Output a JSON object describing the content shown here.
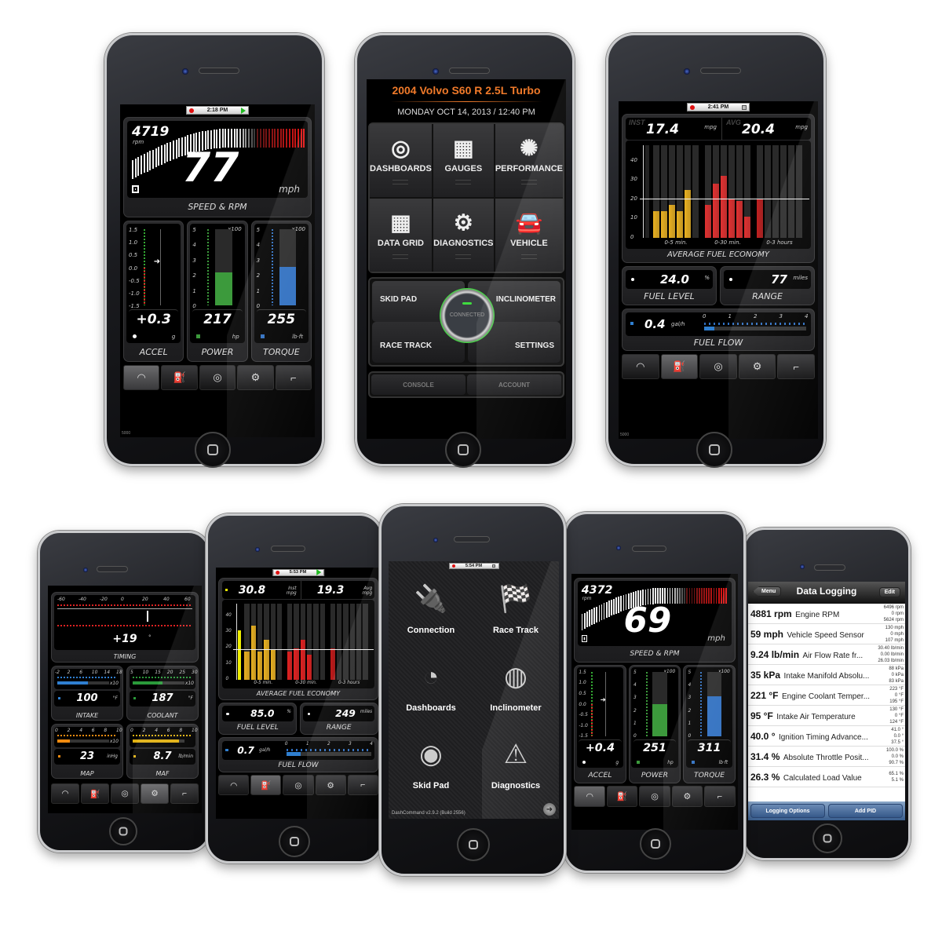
{
  "phone1": {
    "status_time": "2:18 PM",
    "rpm_value": "4719",
    "rpm_unit": "rpm",
    "speed_value": "77",
    "speed_unit": "mph",
    "gauge_title": "SPEED & RPM",
    "accel": {
      "ticks": [
        "1.5",
        "1.0",
        "0.5",
        "0.0",
        "-0.5",
        "-1.0",
        "-1.5"
      ],
      "value": "+0.3",
      "unit": "g",
      "label": "ACCEL"
    },
    "power": {
      "ticks": [
        "5",
        "4",
        "3",
        "2",
        "1",
        "0"
      ],
      "multiplier": "x100",
      "value": "217",
      "unit": "hp",
      "label": "POWER",
      "fill_fraction": 0.434,
      "color": "#3c9a3c"
    },
    "torque": {
      "ticks": [
        "5",
        "4",
        "3",
        "2",
        "1",
        "0"
      ],
      "multiplier": "x100",
      "value": "255",
      "unit": "lb·ft",
      "label": "TORQUE",
      "fill_fraction": 0.51,
      "color": "#2f6fc0"
    },
    "tabbar_caption": "5000",
    "active_tab": 0
  },
  "phone2": {
    "vehicle_title": "2004 Volvo S60 R 2.5L Turbo",
    "datetime": "MONDAY OCT 14, 2013 / 12:40 PM",
    "menu": [
      {
        "label": "DASHBOARDS",
        "icon": "steering-wheel-icon",
        "glyph": "◎"
      },
      {
        "label": "GAUGES",
        "icon": "gauges-chart-icon",
        "glyph": "▦"
      },
      {
        "label": "PERFORMANCE",
        "icon": "turbo-icon",
        "glyph": "✺"
      },
      {
        "label": "DATA GRID",
        "icon": "grid-icon",
        "glyph": "▦"
      },
      {
        "label": "DIAGNOSTICS",
        "icon": "engine-icon",
        "glyph": "⚙"
      },
      {
        "label": "VEHICLE",
        "icon": "car-icon",
        "glyph": "🚘"
      }
    ],
    "quick": {
      "skid_pad": "SKID PAD",
      "inclinometer": "INCLINOMETER",
      "race_track": "RACE TRACK",
      "settings": "SETTINGS",
      "connected": "CONNECTED"
    },
    "bottom": {
      "console": "CONSOLE",
      "account": "ACCOUNT"
    },
    "accent_color": "#f07a2a",
    "connected_color": "#3fdc3f"
  },
  "phone3": {
    "status_time": "2:41 PM",
    "inst_label": "INST",
    "inst_value": "17.4",
    "inst_unit": "mpg",
    "avg_label": "AVG",
    "avg_value": "20.4",
    "avg_unit": "mpg",
    "chart_title": "AVERAGE FUEL ECONOMY",
    "y_ticks": [
      "40",
      "30",
      "20",
      "10",
      "0"
    ],
    "groups": [
      {
        "label": "0-5 min.",
        "color": "#e8b020",
        "values": [
          14,
          14,
          17,
          14,
          25
        ]
      },
      {
        "label": "0-30 min.",
        "color": "#e03030",
        "values": [
          17,
          28,
          32,
          20,
          19,
          11
        ]
      },
      {
        "label": "0-3 hours",
        "color": "#c02020",
        "values": [
          20
        ]
      }
    ],
    "avg_line": 20.4,
    "fuel_level": {
      "value": "24.0",
      "unit": "%",
      "label": "FUEL LEVEL"
    },
    "range": {
      "value": "77",
      "unit": "miles",
      "label": "RANGE"
    },
    "fuel_flow": {
      "value": "0.4",
      "unit": "gal/h",
      "label": "FUEL FLOW",
      "ticks": [
        "0",
        "1",
        "2",
        "3",
        "4"
      ],
      "fill_fraction": 0.1
    },
    "tabbar_caption": "5000",
    "active_tab": 1
  },
  "phone4": {
    "timing": {
      "ticks": [
        "-60",
        "-40",
        "-20",
        "0",
        "20",
        "40",
        "60"
      ],
      "value": "+19",
      "unit": "°",
      "label": "TIMING"
    },
    "intake": {
      "ticks": [
        "-2",
        "2",
        "6",
        "10",
        "14",
        "18"
      ],
      "mult": "x10",
      "value": "100",
      "unit": "°F",
      "label": "INTAKE",
      "fill_fraction": 0.58,
      "color": "#2f7fd0"
    },
    "coolant": {
      "ticks": [
        "5",
        "10",
        "15",
        "20",
        "25",
        "30"
      ],
      "mult": "x10",
      "value": "187",
      "unit": "°F",
      "label": "COOLANT",
      "fill_fraction": 0.56,
      "color": "#2a9a3a"
    },
    "map": {
      "ticks": [
        "0",
        "2",
        "4",
        "6",
        "8",
        "10"
      ],
      "mult": "x10",
      "value": "23",
      "unit": "inHg",
      "label": "MAP",
      "fill_fraction": 0.23,
      "color": "#f08a10"
    },
    "maf": {
      "ticks": [
        "0",
        "2",
        "4",
        "6",
        "8",
        "10"
      ],
      "value": "8.7",
      "unit": "lb/min",
      "label": "MAF",
      "fill_fraction": 0.87,
      "color": "#e0b010"
    },
    "active_tab": 3
  },
  "phone5": {
    "status_time": "5:53 PM",
    "inst_value": "30.8",
    "inst_unit": "Inst mpg",
    "avg_value": "19.3",
    "avg_unit": "Avg mpg",
    "chart_title": "AVERAGE FUEL ECONOMY",
    "y_ticks": [
      "40",
      "30",
      "20",
      "10",
      "0"
    ],
    "inst_bar": 31,
    "groups": [
      {
        "label": "0-5 min.",
        "color": "#e8b020",
        "values": [
          18,
          34,
          18,
          25,
          19
        ]
      },
      {
        "label": "0-30 min.",
        "color": "#e02020",
        "values": [
          18,
          20,
          25,
          16
        ]
      },
      {
        "label": "0-3 hours",
        "color": "#c01818",
        "values": [
          20
        ]
      }
    ],
    "avg_line": 19.3,
    "fuel_level": {
      "value": "85.0",
      "unit": "%",
      "label": "FUEL LEVEL"
    },
    "range": {
      "value": "249",
      "unit": "miles",
      "label": "RANGE"
    },
    "fuel_flow": {
      "value": "0.7",
      "unit": "gal/h",
      "label": "FUEL FLOW",
      "ticks": [
        "0",
        "1",
        "2",
        "3",
        "4"
      ],
      "fill_fraction": 0.17
    },
    "active_tab": 1
  },
  "phone6": {
    "status_time": "5:54 PM",
    "apps": [
      {
        "label": "Connection",
        "icon": "obd-connector-icon",
        "glyph": "🔌"
      },
      {
        "label": "Race Track",
        "icon": "race-car-icon",
        "glyph": "🏁"
      },
      {
        "label": "Dashboards",
        "icon": "dashboards-gauges-icon",
        "glyph": "◔"
      },
      {
        "label": "Inclinometer",
        "icon": "inclinometer-icon",
        "glyph": "◍"
      },
      {
        "label": "Skid Pad",
        "icon": "skid-pad-icon",
        "glyph": "◉"
      },
      {
        "label": "Diagnostics",
        "icon": "car-warning-icon",
        "glyph": "⚠"
      }
    ],
    "version": "DashCommand v2.9.2 (Build 2556)"
  },
  "phone7": {
    "rpm_value": "4372",
    "rpm_unit": "rpm",
    "speed_value": "69",
    "speed_unit": "mph",
    "gauge_title": "SPEED & RPM",
    "accel": {
      "ticks": [
        "1.5",
        "1.0",
        "0.5",
        "0.0",
        "-0.5",
        "-1.0",
        "-1.5"
      ],
      "value": "+0.4",
      "unit": "g",
      "label": "ACCEL"
    },
    "power": {
      "ticks": [
        "5",
        "4",
        "3",
        "2",
        "1",
        "0"
      ],
      "multiplier": "x100",
      "value": "251",
      "unit": "hp",
      "label": "POWER",
      "fill_fraction": 0.502,
      "color": "#3c9a3c"
    },
    "torque": {
      "ticks": [
        "5",
        "4",
        "3",
        "2",
        "1",
        "0"
      ],
      "multiplier": "x100",
      "value": "311",
      "unit": "lb·ft",
      "label": "TORQUE",
      "fill_fraction": 0.622,
      "color": "#2f6fc0"
    },
    "active_tab": 0
  },
  "phone8": {
    "title": "Data Logging",
    "menu_button": "Menu",
    "edit_button": "Edit",
    "rows": [
      {
        "value": "4881 rpm",
        "name": "Engine RPM",
        "max": "6496 rpm",
        "min": "0 rpm",
        "avg": "5624 rpm"
      },
      {
        "value": "59 mph",
        "name": "Vehicle Speed Sensor",
        "max": "130 mph",
        "min": "0 mph",
        "avg": "107 mph"
      },
      {
        "value": "9.24 lb/min",
        "name": "Air Flow Rate fr...",
        "max": "30.40 lb/min",
        "min": "0.00 lb/min",
        "avg": "26.03 lb/min"
      },
      {
        "value": "35 kPa",
        "name": "Intake Manifold Absolu...",
        "max": "88 kPa",
        "min": "0 kPa",
        "avg": "83 kPa"
      },
      {
        "value": "221 °F",
        "name": "Engine Coolant Temper...",
        "max": "223 °F",
        "min": "0 °F",
        "avg": "195 °F"
      },
      {
        "value": "95 °F",
        "name": "Intake Air Temperature",
        "max": "130 °F",
        "min": "0 °F",
        "avg": "124 °F"
      },
      {
        "value": "40.0 °",
        "name": "Ignition Timing Advance...",
        "max": "41.0 °",
        "min": "0.0 °",
        "avg": "37.5 °"
      },
      {
        "value": "31.4 %",
        "name": "Absolute Throttle Posit...",
        "max": "100.0 %",
        "min": "0.0 %",
        "avg": "90.7 %"
      },
      {
        "value": "26.3 %",
        "name": "Calculated Load Value",
        "max": "65.1 %",
        "min": "5.1 %",
        "avg": ""
      }
    ],
    "logging_options": "Logging Options",
    "add_pid": "Add PID"
  },
  "tab_icons": [
    {
      "name": "gauge-tab-icon",
      "glyph": "◠"
    },
    {
      "name": "fuel-pump-tab-icon",
      "glyph": "⛽"
    },
    {
      "name": "steering-wheel-tab-icon",
      "glyph": "◎"
    },
    {
      "name": "engine-tab-icon",
      "glyph": "⚙"
    },
    {
      "name": "fuel-nozzle-tab-icon",
      "glyph": "⌐"
    }
  ]
}
